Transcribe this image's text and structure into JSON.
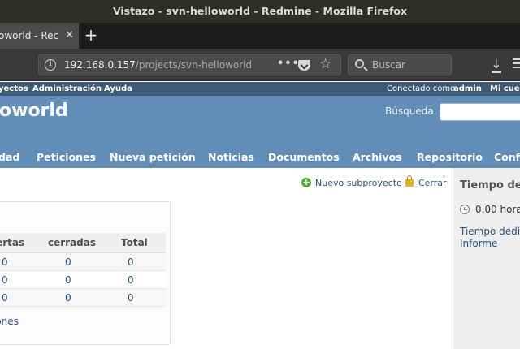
{
  "window": {
    "title": "Vistazo - svn-helloworld - Redmine - Mozilla Firefox"
  },
  "browser": {
    "tab_label": "oworld - Rec",
    "tab_close": "✕",
    "new_tab": "+",
    "url_host": "192.168.0.157",
    "url_path": "/projects/svn-helloworld",
    "page_actions": "•••",
    "search_placeholder": "Buscar",
    "info_icon": "i",
    "star_icon": "☆",
    "download_icon": "↓"
  },
  "topmenu": {
    "items": [
      "yectos",
      "Administración",
      "Ayuda"
    ],
    "logged_prefix": "Conectado como",
    "user": "admin",
    "my_account": "Mi cuen"
  },
  "header": {
    "project_title": "oworld",
    "search_label": "Búsqueda:"
  },
  "mainmenu": {
    "items": [
      "dad",
      "Peticiones",
      "Nueva petición",
      "Noticias",
      "Documentos",
      "Archivos",
      "Repositorio",
      "Confi"
    ]
  },
  "content": {
    "new_subproject": "Nuevo subproyecto",
    "close": "Cerrar",
    "plus_icon": "+",
    "issues": {
      "heading": "s",
      "columns": [
        "iertas",
        "cerradas",
        "Total"
      ],
      "rows": [
        [
          "0",
          "0",
          "0"
        ],
        [
          "0",
          "0",
          "0"
        ],
        [
          "0",
          "0",
          "0"
        ]
      ],
      "view_all": "iones"
    }
  },
  "sidebar": {
    "title": "Tiempo de",
    "hours": "0.00 hora",
    "links": [
      "Tiempo dedic",
      "Informe"
    ]
  }
}
